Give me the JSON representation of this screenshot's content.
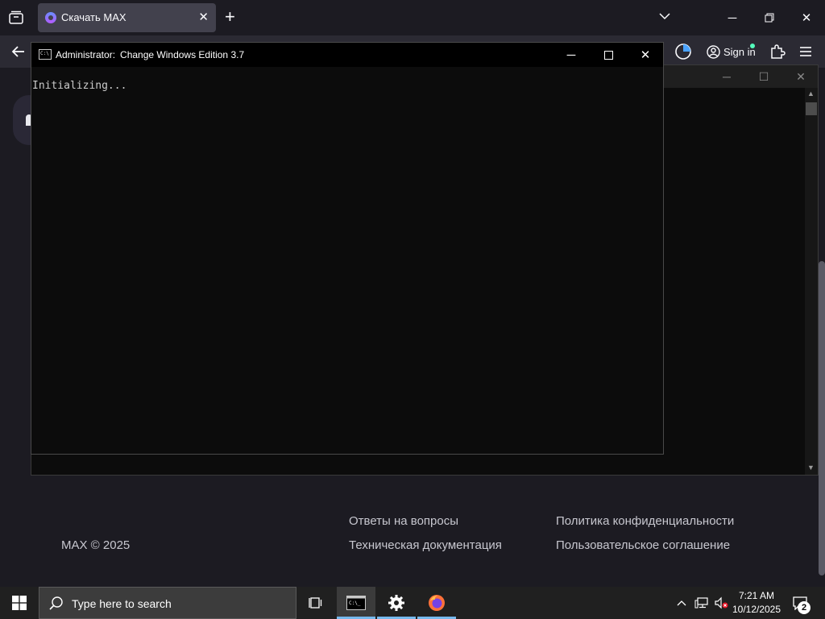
{
  "browser": {
    "tab_title": "Скачать MAX",
    "signin_label": "Sign in"
  },
  "page": {
    "footer": {
      "copyright": "MAX © 2025",
      "links": [
        "Ответы на вопросы",
        "Техническая документация",
        "Политика конфиденциальности",
        "Пользовательское соглашение"
      ]
    }
  },
  "console_window": {
    "title_admin": "Administrator:",
    "title_app": "Change Windows Edition 3.7",
    "output": "Initializing..."
  },
  "taskbar": {
    "search_placeholder": "Type here to search",
    "time": "7:21 AM",
    "date": "10/12/2025",
    "notification_count": "2"
  },
  "colors": {
    "browser_bg": "#1c1b22",
    "toolbar_bg": "#2b2a33",
    "console_bg": "#0c0c0c",
    "taskbar_bg": "#202020",
    "taskbar_active_underline": "#76b9ed"
  }
}
